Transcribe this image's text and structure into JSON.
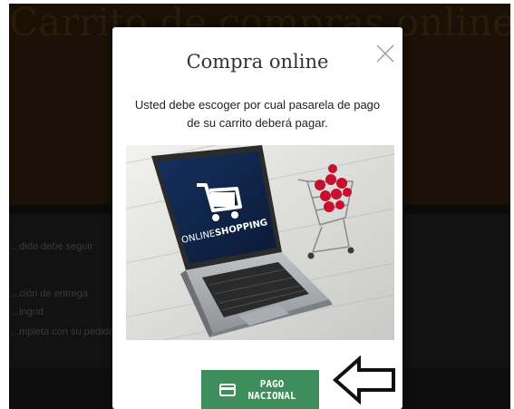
{
  "background": {
    "hero_title": "Carrito de compras online",
    "lines": [
      "...dido debe seguir",
      "...ción de entrega",
      "...ingrid",
      "...mpleta con su pedido"
    ]
  },
  "modal": {
    "title": "Compra online",
    "description": "Usted debe escoger por cual pasarela de pago de su carrito deberá pagar.",
    "image": {
      "screen_text_prefix": "ONLINE",
      "screen_text_bold": "SHOPPING"
    },
    "pay_button": {
      "line1": "PAGO",
      "line2": "NACIONAL"
    },
    "icons": {
      "close": "close-icon",
      "card": "credit-card-icon",
      "arrow": "arrow-left-outline-icon"
    },
    "colors": {
      "button": "#3e8d5a",
      "overlay": "#0b0b0b",
      "modal_bg": "#ffffff"
    }
  }
}
